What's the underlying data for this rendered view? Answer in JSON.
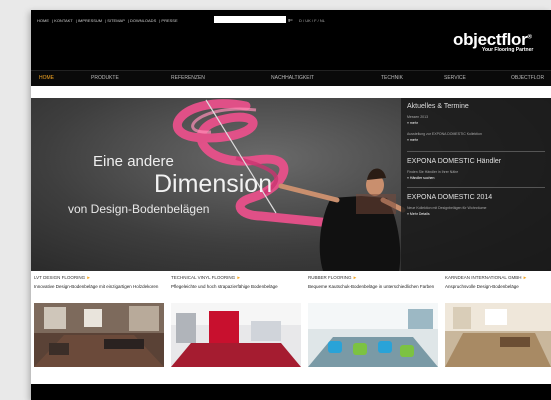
{
  "util_nav": [
    "HOME",
    "KONTAKT",
    "IMPRESSUM",
    "SITEMAP",
    "DOWNLOADS",
    "PRESSE"
  ],
  "search": {
    "go": "go"
  },
  "languages": "D / UK / F / NL",
  "logo": {
    "text": "objectflor",
    "tagline": "Your Flooring Partner"
  },
  "main_nav": [
    "HOME",
    "PRODUKTE",
    "REFERENZEN",
    "NACHHALTIGKEIT",
    "TECHNIK",
    "SERVICE",
    "OBJECTFLOR"
  ],
  "hero": {
    "line1": "Eine andere",
    "line2": "Dimension",
    "line3": "von Design-Bodenbelägen"
  },
  "news": {
    "title": "Aktuelles & Termine",
    "item1_sub": "Messen 2013",
    "item1_more": "» mehr",
    "item2_sub": "Ausstellung zur EXPONA DOMESTIC Kollektion",
    "item2_more": "» mehr",
    "item3_head": "EXPONA DOMESTIC Händler",
    "item3_sub": "Finden Sie Händler in Ihrer Nähe",
    "item3_more": "» Händler suchen",
    "item4_head": "EXPONA DOMESTIC 2014",
    "item4_sub": "Neue Kollektion mit Designbelägen für Wohnräume",
    "item4_more": "» Mehr Details"
  },
  "tiles": [
    {
      "title": "LVT DESIGN FLOORING",
      "desc": "Innovative Design-Bodenbeläge mit einzigartigen Holzdekoren"
    },
    {
      "title": "TECHNICAL VINYL FLOORING",
      "desc": "Pflegeleichte und hoch strapazierfähige Bodenbeläge"
    },
    {
      "title": "RUBBER FLOORING",
      "desc": "Bequeme Kautschuk-Bodenbeläge in unterschiedlichen Farben"
    },
    {
      "title": "KARNDEAN INTERNATIONAL GMBH",
      "desc": "Anspruchsvolle Design-Bodenbeläge"
    }
  ],
  "colors": {
    "accent": "#f5a623",
    "ribbon": "#e8508a"
  }
}
